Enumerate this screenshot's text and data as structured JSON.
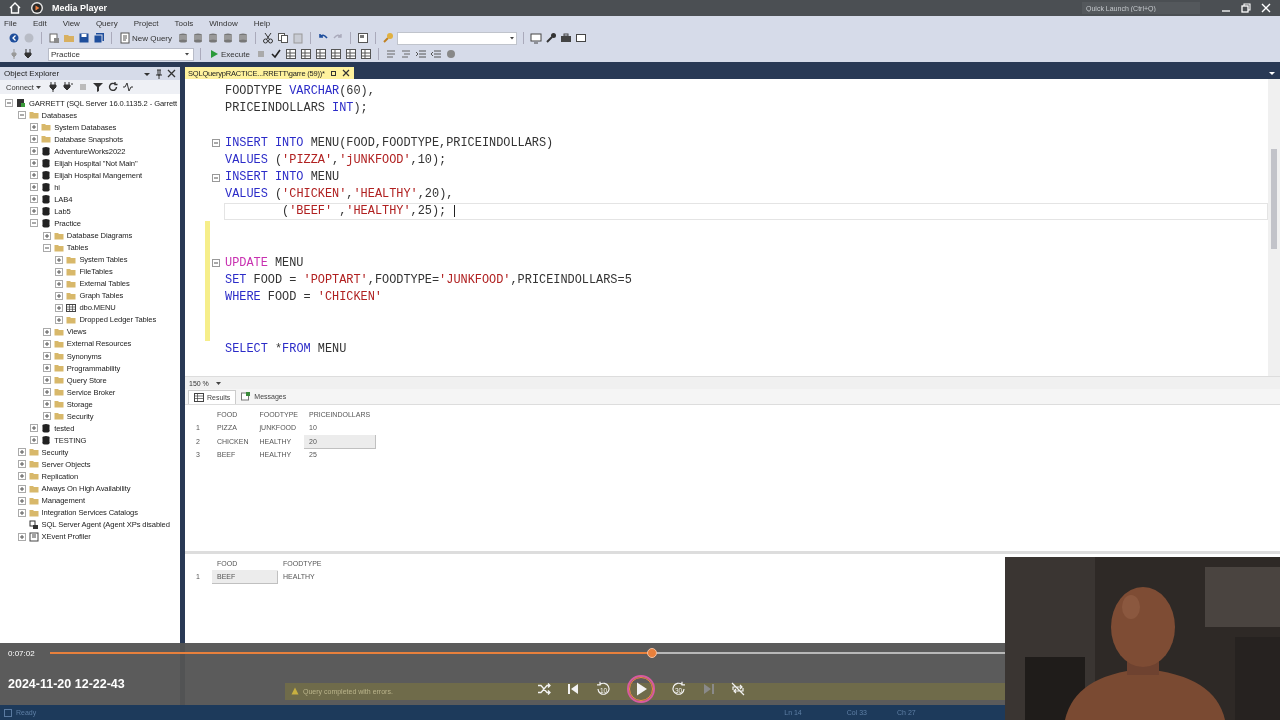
{
  "player": {
    "title": "Media Player",
    "elapsed": "0:07:02",
    "level": 0.63,
    "timestamp": "2024-11-20 12-22-43",
    "controls": [
      {
        "kind": "shuffle",
        "disabled": false
      },
      {
        "kind": "previous",
        "disabled": false
      },
      {
        "kind": "back",
        "label": "10",
        "disabled": false
      },
      {
        "kind": "play",
        "disabled": false
      },
      {
        "kind": "forward",
        "label": "30",
        "disabled": false
      },
      {
        "kind": "next",
        "disabled": true
      },
      {
        "kind": "repeat-off",
        "disabled": false
      }
    ]
  },
  "window": {
    "quick_launch": {
      "placeholder": "Quick Launch (Ctrl+Q)"
    }
  },
  "menu": [
    "File",
    "Edit",
    "View",
    "Query",
    "Project",
    "Tools",
    "Window",
    "Help"
  ],
  "toolbar": {
    "new_query": "New Query",
    "database": "Practice",
    "execute": "Execute"
  },
  "object_explorer": {
    "title": "Object Explorer",
    "connect": "Connect",
    "tree": [
      {
        "label": "GARRETT (SQL Server 16.0.1135.2 - Garrett",
        "kind": "server",
        "expanded": true,
        "children": [
          {
            "label": "Databases",
            "kind": "folder",
            "expanded": true,
            "children": [
              {
                "label": "System Databases",
                "kind": "folder",
                "expanded": false
              },
              {
                "label": "Database Snapshots",
                "kind": "folder",
                "expanded": false
              },
              {
                "label": "AdventureWorks2022",
                "kind": "database",
                "expanded": false
              },
              {
                "label": "Elijah Hospital \"Not Main\"",
                "kind": "database",
                "expanded": false
              },
              {
                "label": "Elijah Hospital Mangement",
                "kind": "database",
                "expanded": false
              },
              {
                "label": "hi",
                "kind": "database",
                "expanded": false
              },
              {
                "label": "LAB4",
                "kind": "database",
                "expanded": false
              },
              {
                "label": "Lab5",
                "kind": "database",
                "expanded": false
              },
              {
                "label": "Practice",
                "kind": "database",
                "expanded": true,
                "children": [
                  {
                    "label": "Database Diagrams",
                    "kind": "folder",
                    "expanded": false
                  },
                  {
                    "label": "Tables",
                    "kind": "folder",
                    "expanded": true,
                    "children": [
                      {
                        "label": "System Tables",
                        "kind": "folder",
                        "expanded": false
                      },
                      {
                        "label": "FileTables",
                        "kind": "folder",
                        "expanded": false
                      },
                      {
                        "label": "External Tables",
                        "kind": "folder",
                        "expanded": false
                      },
                      {
                        "label": "Graph Tables",
                        "kind": "folder",
                        "expanded": false
                      },
                      {
                        "label": "dbo.MENU",
                        "kind": "table",
                        "expanded": false
                      },
                      {
                        "label": "Dropped Ledger Tables",
                        "kind": "folder",
                        "expanded": false
                      }
                    ]
                  },
                  {
                    "label": "Views",
                    "kind": "folder",
                    "expanded": false
                  },
                  {
                    "label": "External Resources",
                    "kind": "folder",
                    "expanded": false
                  },
                  {
                    "label": "Synonyms",
                    "kind": "folder",
                    "expanded": false
                  },
                  {
                    "label": "Programmability",
                    "kind": "folder",
                    "expanded": false
                  },
                  {
                    "label": "Query Store",
                    "kind": "folder",
                    "expanded": false
                  },
                  {
                    "label": "Service Broker",
                    "kind": "folder",
                    "expanded": false
                  },
                  {
                    "label": "Storage",
                    "kind": "folder",
                    "expanded": false
                  },
                  {
                    "label": "Security",
                    "kind": "folder",
                    "expanded": false
                  }
                ]
              },
              {
                "label": "tested",
                "kind": "database",
                "expanded": false
              },
              {
                "label": "TESTING",
                "kind": "database",
                "expanded": false
              }
            ]
          },
          {
            "label": "Security",
            "kind": "folder",
            "expanded": false
          },
          {
            "label": "Server Objects",
            "kind": "folder",
            "expanded": false
          },
          {
            "label": "Replication",
            "kind": "folder",
            "expanded": false
          },
          {
            "label": "Always On High Availability",
            "kind": "folder",
            "expanded": false
          },
          {
            "label": "Management",
            "kind": "folder",
            "expanded": false
          },
          {
            "label": "Integration Services Catalogs",
            "kind": "folder",
            "expanded": false
          },
          {
            "label": "SQL Server Agent (Agent XPs disabled",
            "kind": "agent"
          },
          {
            "label": "XEvent Profiler",
            "kind": "profiler",
            "expanded": false
          }
        ]
      }
    ]
  },
  "editor": {
    "tab": "SQLQuerypRACTICE...RRETT\\garre (59))*",
    "lines": [
      {
        "kind": "code",
        "segments": [
          {
            "kind": "text",
            "text": "FOODTYPE "
          },
          {
            "kind": "keyword",
            "text": "VARCHAR"
          },
          {
            "kind": "text",
            "text": "(60),"
          }
        ]
      },
      {
        "kind": "code",
        "segments": [
          {
            "kind": "text",
            "text": "PRICEINDOLLARS "
          },
          {
            "kind": "keyword",
            "text": "INT"
          },
          {
            "kind": "text",
            "text": ");"
          }
        ]
      },
      {
        "kind": "blank"
      },
      {
        "kind": "code",
        "fold": true,
        "segments": [
          {
            "kind": "keyword",
            "text": "INSERT INTO"
          },
          {
            "kind": "text",
            "text": " MENU(FOOD,FOODTYPE,PRICEINDOLLARS)"
          }
        ]
      },
      {
        "kind": "code",
        "segments": [
          {
            "kind": "keyword",
            "text": "VALUES"
          },
          {
            "kind": "text",
            "text": " ("
          },
          {
            "kind": "string",
            "text": "'PIZZA'"
          },
          {
            "kind": "text",
            "text": ","
          },
          {
            "kind": "string",
            "text": "'jUNKFOOD'"
          },
          {
            "kind": "text",
            "text": ",10);"
          }
        ]
      },
      {
        "kind": "code",
        "fold": true,
        "segments": [
          {
            "kind": "keyword",
            "text": "INSERT INTO"
          },
          {
            "kind": "text",
            "text": " MENU"
          }
        ]
      },
      {
        "kind": "code",
        "segments": [
          {
            "kind": "keyword",
            "text": "VALUES"
          },
          {
            "kind": "text",
            "text": " ("
          },
          {
            "kind": "string",
            "text": "'CHICKEN'"
          },
          {
            "kind": "text",
            "text": ","
          },
          {
            "kind": "string",
            "text": "'HEALTHY'"
          },
          {
            "kind": "text",
            "text": ",20),"
          }
        ]
      },
      {
        "kind": "code",
        "current": true,
        "segments": [
          {
            "kind": "text",
            "text": "        ("
          },
          {
            "kind": "string",
            "text": "'BEEF'"
          },
          {
            "kind": "text",
            "text": " ,"
          },
          {
            "kind": "string",
            "text": "'HEALTHY'"
          },
          {
            "kind": "text",
            "text": ",25);"
          }
        ]
      },
      {
        "kind": "blank",
        "changed": true
      },
      {
        "kind": "blank",
        "changed": true
      },
      {
        "kind": "code",
        "fold": true,
        "changed": true,
        "segments": [
          {
            "kind": "dml",
            "text": "UPDATE"
          },
          {
            "kind": "text",
            "text": " MENU"
          }
        ]
      },
      {
        "kind": "code",
        "changed": true,
        "segments": [
          {
            "kind": "keyword",
            "text": "SET"
          },
          {
            "kind": "text",
            "text": " FOOD = "
          },
          {
            "kind": "string",
            "text": "'POPTART'"
          },
          {
            "kind": "text",
            "text": ",FOODTYPE="
          },
          {
            "kind": "string",
            "text": "'JUNKFOOD'"
          },
          {
            "kind": "text",
            "text": ",PRICEINDOLLARS=5"
          }
        ]
      },
      {
        "kind": "code",
        "changed": true,
        "segments": [
          {
            "kind": "keyword",
            "text": "WHERE"
          },
          {
            "kind": "text",
            "text": " FOOD = "
          },
          {
            "kind": "string",
            "text": "'CHICKEN'"
          }
        ]
      },
      {
        "kind": "blank",
        "changed": true
      },
      {
        "kind": "blank",
        "changed": true
      },
      {
        "kind": "code",
        "segments": [
          {
            "kind": "keyword",
            "text": "SELECT"
          },
          {
            "kind": "text",
            "text": " *"
          },
          {
            "kind": "keyword",
            "text": "FROM"
          },
          {
            "kind": "text",
            "text": " MENU"
          }
        ]
      }
    ],
    "zoom": "150 %"
  },
  "results": {
    "tabs": [
      {
        "label": "Results",
        "kind": "grid",
        "selected": true
      },
      {
        "label": "Messages",
        "kind": "messages",
        "selected": false
      }
    ],
    "grids": [
      {
        "columns": [
          "FOOD",
          "FOODTYPE",
          "PRICEINDOLLARS"
        ],
        "rows": [
          {
            "number": "1",
            "cells": [
              {
                "text": "PIZZA",
                "selected": false
              },
              {
                "text": "jUNKFOOD",
                "selected": false
              },
              {
                "text": "10",
                "selected": false
              }
            ]
          },
          {
            "number": "2",
            "cells": [
              {
                "text": "CHICKEN",
                "selected": false
              },
              {
                "text": "HEALTHY",
                "selected": false
              },
              {
                "text": "20",
                "selected": true
              }
            ]
          },
          {
            "number": "3",
            "cells": [
              {
                "text": "BEEF",
                "selected": false
              },
              {
                "text": "HEALTHY",
                "selected": false
              },
              {
                "text": "25",
                "selected": false
              }
            ]
          }
        ]
      },
      {
        "columns": [
          "FOOD",
          "FOODTYPE"
        ],
        "rows": [
          {
            "number": "1",
            "cells": [
              {
                "text": "BEEF",
                "selected": true
              },
              {
                "text": "HEALTHY",
                "selected": false
              }
            ]
          }
        ]
      }
    ]
  },
  "query_status": "Query completed with errors.",
  "status_bar": {
    "state": "Ready",
    "line": "Ln 14",
    "column": "Col 33",
    "char": "Ch 27"
  }
}
